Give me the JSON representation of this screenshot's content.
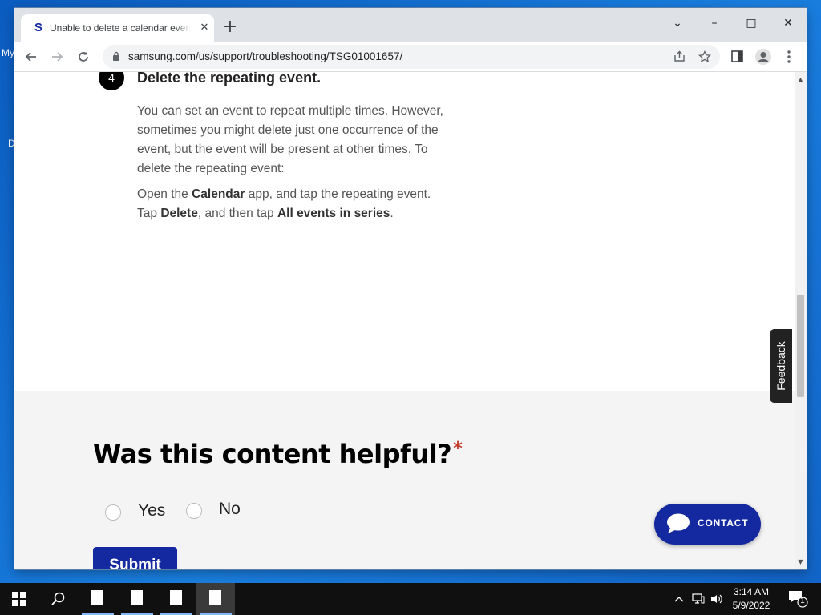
{
  "desktop": {
    "fragments": [
      "My",
      "D"
    ]
  },
  "browser": {
    "tab": {
      "favicon": "S",
      "title": "Unable to delete a calendar event",
      "close": "✕"
    },
    "new_tab": "+",
    "window_controls": {
      "tab_search": "⌄",
      "minimize": "–",
      "maximize": "□",
      "close": "✕"
    },
    "url": "samsung.com/us/support/troubleshooting/TSG01001657/"
  },
  "page": {
    "step": {
      "number": "4",
      "title": "Delete the repeating event.",
      "paragraph": "You can set an event to repeat multiple times. However, sometimes you might delete just one occurrence of the event, but the event will be present at other times. To delete the repeating event:",
      "instr_open": "Open the ",
      "instr_calendar": "Calendar",
      "instr_app": " app, and tap the repeating event.",
      "instr_tap": "Tap ",
      "instr_delete": "Delete",
      "instr_then": ", and then tap ",
      "instr_all": "All events in series",
      "instr_end": "."
    },
    "feedback_question": "Was this content helpful?",
    "required_mark": "*",
    "options": [
      "Yes",
      "No"
    ],
    "submit": "Submit",
    "feedback_tab": "Feedback",
    "contact": "CONTACT"
  },
  "taskbar": {
    "time": "3:14 AM",
    "date": "5/9/2022",
    "notification_count": "1"
  },
  "colors": {
    "samsung_blue": "#1428a0",
    "required_red": "#c0392b"
  }
}
